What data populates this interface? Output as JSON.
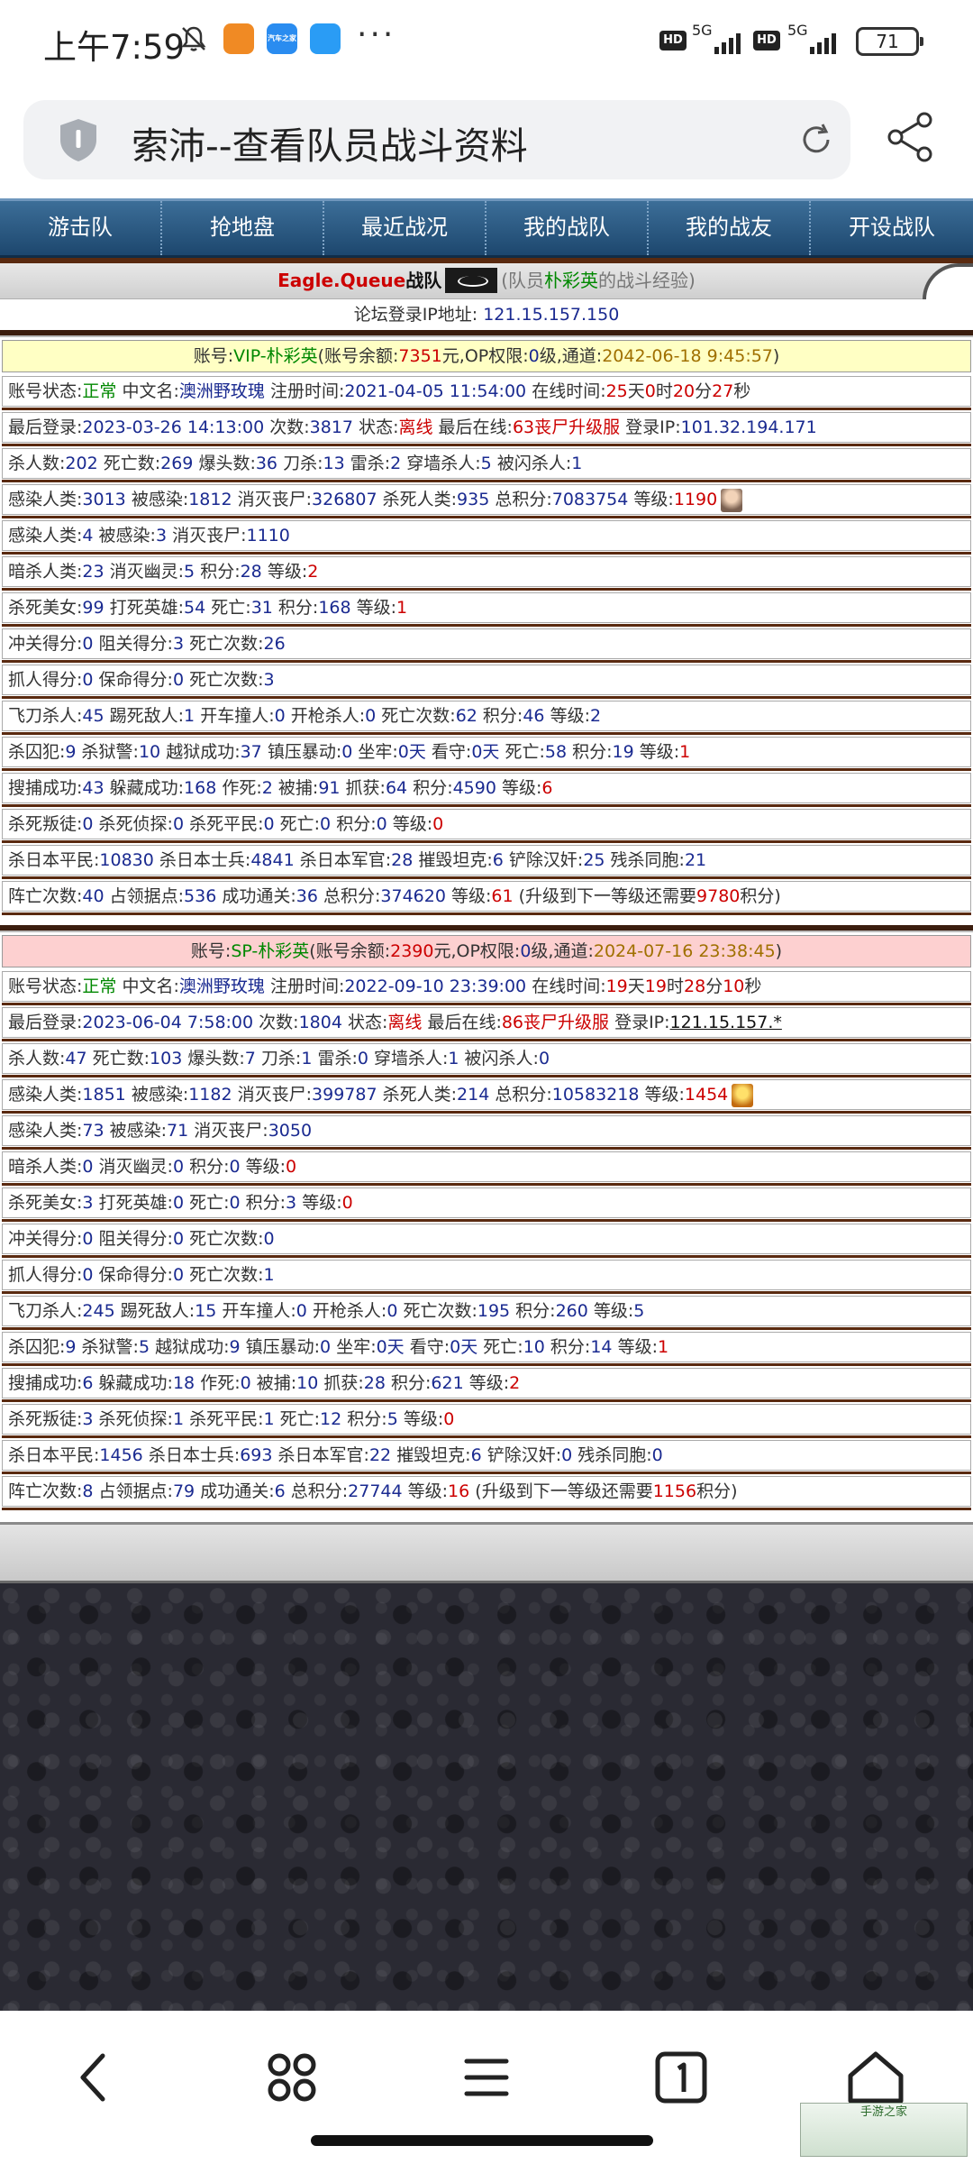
{
  "status_bar": {
    "time": "上午7:59",
    "more": "···",
    "hd_1": "HD",
    "signal_1": "5G",
    "hd_2": "HD",
    "signal_2": "5G",
    "battery": "71",
    "app_icon_2_text": "汽车之家"
  },
  "browser": {
    "title": "索沛--查看队员战斗资料"
  },
  "nav": {
    "items": [
      "游击队",
      "抢地盘",
      "最近战况",
      "我的战队",
      "我的战友",
      "开设战队"
    ]
  },
  "team_header": {
    "team_name": "Eagle.Queue",
    "team_suffix": "战队",
    "paren_open": "(队员",
    "member": "朴彩英",
    "paren_close": "的战斗经验)",
    "ip_label": "论坛登录IP地址:",
    "ip_value": "121.15.157.150"
  },
  "vip": {
    "account": {
      "label": "账号:",
      "name": "VIP-朴彩英",
      "balance_label": "(账号余额:",
      "balance": "7351",
      "balance_unit": "元,OP权限:",
      "op_level": "0",
      "op_unit": "级,通道:",
      "channel": "2042-06-18 9:45:57",
      "close": ")"
    },
    "rows": {
      "status": {
        "status_label": "账号状态:",
        "status": "正常",
        "cn_label": "中文名:",
        "cn": "澳洲野玫瑰",
        "reg_label": "注册时间:",
        "reg": "2021-04-05 11:54:00",
        "online_label": "在线时间:",
        "d": "25",
        "du": "天",
        "h": "0",
        "hu": "时",
        "m": "20",
        "mu": "分",
        "s": "27",
        "su": "秒"
      },
      "login": {
        "last_label": "最后登录:",
        "last": "2023-03-26 14:13:00",
        "count_label": "次数:",
        "count": "3817",
        "state_label": "状态:",
        "state": "离线",
        "lastonline_label": "最后在线:",
        "lastonline": "63丧尸升级服",
        "ip_label": "登录IP:",
        "ip": "101.32.194.171"
      },
      "kills": {
        "l1": "杀人数:",
        "v1": "202",
        "l2": "死亡数:",
        "v2": "269",
        "l3": "爆头数:",
        "v3": "36",
        "l4": "刀杀:",
        "v4": "13",
        "l5": "雷杀:",
        "v5": "2",
        "l6": "穿墙杀人:",
        "v6": "5",
        "l7": "被闪杀人:",
        "v7": "1"
      },
      "infect": {
        "l1": "感染人类:",
        "v1": "3013",
        "l2": "被感染:",
        "v2": "1812",
        "l3": "消灭丧尸:",
        "v3": "326807",
        "l4": "杀死人类:",
        "v4": "935",
        "l5": "总积分:",
        "v5": "7083754",
        "l6": "等级:",
        "v6": "1190"
      },
      "infect2": {
        "l1": "感染人类:",
        "v1": "4",
        "l2": "被感染:",
        "v2": "3",
        "l3": "消灭丧尸:",
        "v3": "1110"
      },
      "assassin": {
        "l1": "暗杀人类:",
        "v1": "23",
        "l2": "消灭幽灵:",
        "v2": "5",
        "l3": "积分:",
        "v3": "28",
        "l4": "等级:",
        "v4": "2"
      },
      "beauty": {
        "l1": "杀死美女:",
        "v1": "99",
        "l2": "打死英雄:",
        "v2": "54",
        "l3": "死亡:",
        "v3": "31",
        "l4": "积分:",
        "v4": "168",
        "l5": "等级:",
        "v5": "1"
      },
      "rush": {
        "l1": "冲关得分:",
        "v1": "0",
        "l2": "阻关得分:",
        "v2": "3",
        "l3": "死亡次数:",
        "v3": "26"
      },
      "catch": {
        "l1": "抓人得分:",
        "v1": "0",
        "l2": "保命得分:",
        "v2": "0",
        "l3": "死亡次数:",
        "v3": "3"
      },
      "knife": {
        "l1": "飞刀杀人:",
        "v1": "45",
        "l2": "踢死敌人:",
        "v2": "1",
        "l3": "开车撞人:",
        "v3": "0",
        "l4": "开枪杀人:",
        "v4": "0",
        "l5": "死亡次数:",
        "v5": "62",
        "l6": "积分:",
        "v6": "46",
        "l7": "等级:",
        "v7": "2"
      },
      "prison": {
        "l1": "杀囚犯:",
        "v1": "9",
        "l2": "杀狱警:",
        "v2": "10",
        "l3": "越狱成功:",
        "v3": "37",
        "l4": "镇压暴动:",
        "v4": "0",
        "l5": "坐牢:",
        "v5": "0天",
        "l6": "看守:",
        "v6": "0天",
        "l7": "死亡:",
        "v7": "58",
        "l8": "积分:",
        "v8": "19",
        "l9": "等级:",
        "v9": "1"
      },
      "search": {
        "l1": "搜捕成功:",
        "v1": "43",
        "l2": "躲藏成功:",
        "v2": "168",
        "l3": "作死:",
        "v3": "2",
        "l4": "被捕:",
        "v4": "91",
        "l5": "抓获:",
        "v5": "64",
        "l6": "积分:",
        "v6": "4590",
        "l7": "等级:",
        "v7": "6"
      },
      "traitor": {
        "l1": "杀死叛徒:",
        "v1": "0",
        "l2": "杀死侦探:",
        "v2": "0",
        "l3": "杀死平民:",
        "v3": "0",
        "l4": "死亡:",
        "v4": "0",
        "l5": "积分:",
        "v5": "0",
        "l6": "等级:",
        "v6": "0"
      },
      "japan": {
        "l1": "杀日本平民:",
        "v1": "10830",
        "l2": "杀日本士兵:",
        "v2": "4841",
        "l3": "杀日本军官:",
        "v3": "28",
        "l4": "摧毁坦克:",
        "v4": "6",
        "l5": "铲除汉奸:",
        "v5": "25",
        "l6": "残杀同胞:",
        "v6": "21"
      },
      "campaign": {
        "l1": "阵亡次数:",
        "v1": "40",
        "l2": "占领据点:",
        "v2": "536",
        "l3": "成功通关:",
        "v3": "36",
        "l4": "总积分:",
        "v4": "374620",
        "l5": "等级:",
        "v5": "61",
        "t1": "(升级到下一等级还需要",
        "v6": "9780",
        "t2": "积分)"
      }
    }
  },
  "sp": {
    "account": {
      "label": "账号:",
      "name": "SP-朴彩英",
      "balance_label": "(账号余额:",
      "balance": "2390",
      "balance_unit": "元,OP权限:",
      "op_level": "0",
      "op_unit": "级,通道:",
      "channel": "2024-07-16 23:38:45",
      "close": ")"
    },
    "rows": {
      "status": {
        "status_label": "账号状态:",
        "status": "正常",
        "cn_label": "中文名:",
        "cn": "澳洲野玫瑰",
        "reg_label": "注册时间:",
        "reg": "2022-09-10 23:39:00",
        "online_label": "在线时间:",
        "d": "19",
        "du": "天",
        "h": "19",
        "hu": "时",
        "m": "28",
        "mu": "分",
        "s": "10",
        "su": "秒"
      },
      "login": {
        "last_label": "最后登录:",
        "last": "2023-06-04 7:58:00",
        "count_label": "次数:",
        "count": "1804",
        "state_label": "状态:",
        "state": "离线",
        "lastonline_label": "最后在线:",
        "lastonline": "86丧尸升级服",
        "ip_label": "登录IP:",
        "ip": "121.15.157.*"
      },
      "kills": {
        "l1": "杀人数:",
        "v1": "47",
        "l2": "死亡数:",
        "v2": "103",
        "l3": "爆头数:",
        "v3": "7",
        "l4": "刀杀:",
        "v4": "1",
        "l5": "雷杀:",
        "v5": "0",
        "l6": "穿墙杀人:",
        "v6": "1",
        "l7": "被闪杀人:",
        "v7": "0"
      },
      "infect": {
        "l1": "感染人类:",
        "v1": "1851",
        "l2": "被感染:",
        "v2": "1182",
        "l3": "消灭丧尸:",
        "v3": "399787",
        "l4": "杀死人类:",
        "v4": "214",
        "l5": "总积分:",
        "v5": "10583218",
        "l6": "等级:",
        "v6": "1454"
      },
      "infect2": {
        "l1": "感染人类:",
        "v1": "73",
        "l2": "被感染:",
        "v2": "71",
        "l3": "消灭丧尸:",
        "v3": "3050"
      },
      "assassin": {
        "l1": "暗杀人类:",
        "v1": "0",
        "l2": "消灭幽灵:",
        "v2": "0",
        "l3": "积分:",
        "v3": "0",
        "l4": "等级:",
        "v4": "0"
      },
      "beauty": {
        "l1": "杀死美女:",
        "v1": "3",
        "l2": "打死英雄:",
        "v2": "0",
        "l3": "死亡:",
        "v3": "0",
        "l4": "积分:",
        "v4": "3",
        "l5": "等级:",
        "v5": "0"
      },
      "rush": {
        "l1": "冲关得分:",
        "v1": "0",
        "l2": "阻关得分:",
        "v2": "0",
        "l3": "死亡次数:",
        "v3": "0"
      },
      "catch": {
        "l1": "抓人得分:",
        "v1": "0",
        "l2": "保命得分:",
        "v2": "0",
        "l3": "死亡次数:",
        "v3": "1"
      },
      "knife": {
        "l1": "飞刀杀人:",
        "v1": "245",
        "l2": "踢死敌人:",
        "v2": "15",
        "l3": "开车撞人:",
        "v3": "0",
        "l4": "开枪杀人:",
        "v4": "0",
        "l5": "死亡次数:",
        "v5": "195",
        "l6": "积分:",
        "v6": "260",
        "l7": "等级:",
        "v7": "5"
      },
      "prison": {
        "l1": "杀囚犯:",
        "v1": "9",
        "l2": "杀狱警:",
        "v2": "5",
        "l3": "越狱成功:",
        "v3": "9",
        "l4": "镇压暴动:",
        "v4": "0",
        "l5": "坐牢:",
        "v5": "0天",
        "l6": "看守:",
        "v6": "0天",
        "l7": "死亡:",
        "v7": "10",
        "l8": "积分:",
        "v8": "14",
        "l9": "等级:",
        "v9": "1"
      },
      "search": {
        "l1": "搜捕成功:",
        "v1": "6",
        "l2": "躲藏成功:",
        "v2": "18",
        "l3": "作死:",
        "v3": "0",
        "l4": "被捕:",
        "v4": "10",
        "l5": "抓获:",
        "v5": "28",
        "l6": "积分:",
        "v6": "621",
        "l7": "等级:",
        "v7": "2"
      },
      "traitor": {
        "l1": "杀死叛徒:",
        "v1": "3",
        "l2": "杀死侦探:",
        "v2": "1",
        "l3": "杀死平民:",
        "v3": "1",
        "l4": "死亡:",
        "v4": "12",
        "l5": "积分:",
        "v5": "5",
        "l6": "等级:",
        "v6": "0"
      },
      "japan": {
        "l1": "杀日本平民:",
        "v1": "1456",
        "l2": "杀日本士兵:",
        "v2": "693",
        "l3": "杀日本军官:",
        "v3": "22",
        "l4": "摧毁坦克:",
        "v4": "6",
        "l5": "铲除汉奸:",
        "v5": "0",
        "l6": "残杀同胞:",
        "v6": "0"
      },
      "campaign": {
        "l1": "阵亡次数:",
        "v1": "8",
        "l2": "占领据点:",
        "v2": "79",
        "l3": "成功通关:",
        "v3": "6",
        "l4": "总积分:",
        "v4": "27744",
        "l5": "等级:",
        "v5": "16",
        "t1": "(升级到下一等级还需要",
        "v6": "1156",
        "t2": "积分)"
      }
    }
  },
  "watermark": "手游之家",
  "colors": {
    "nav_bg": "#2a5a85",
    "accent_blue": "#1a2a90",
    "accent_red": "#cc0000",
    "vip_row": "#ffffc4",
    "sp_row": "#fdd0d0"
  }
}
